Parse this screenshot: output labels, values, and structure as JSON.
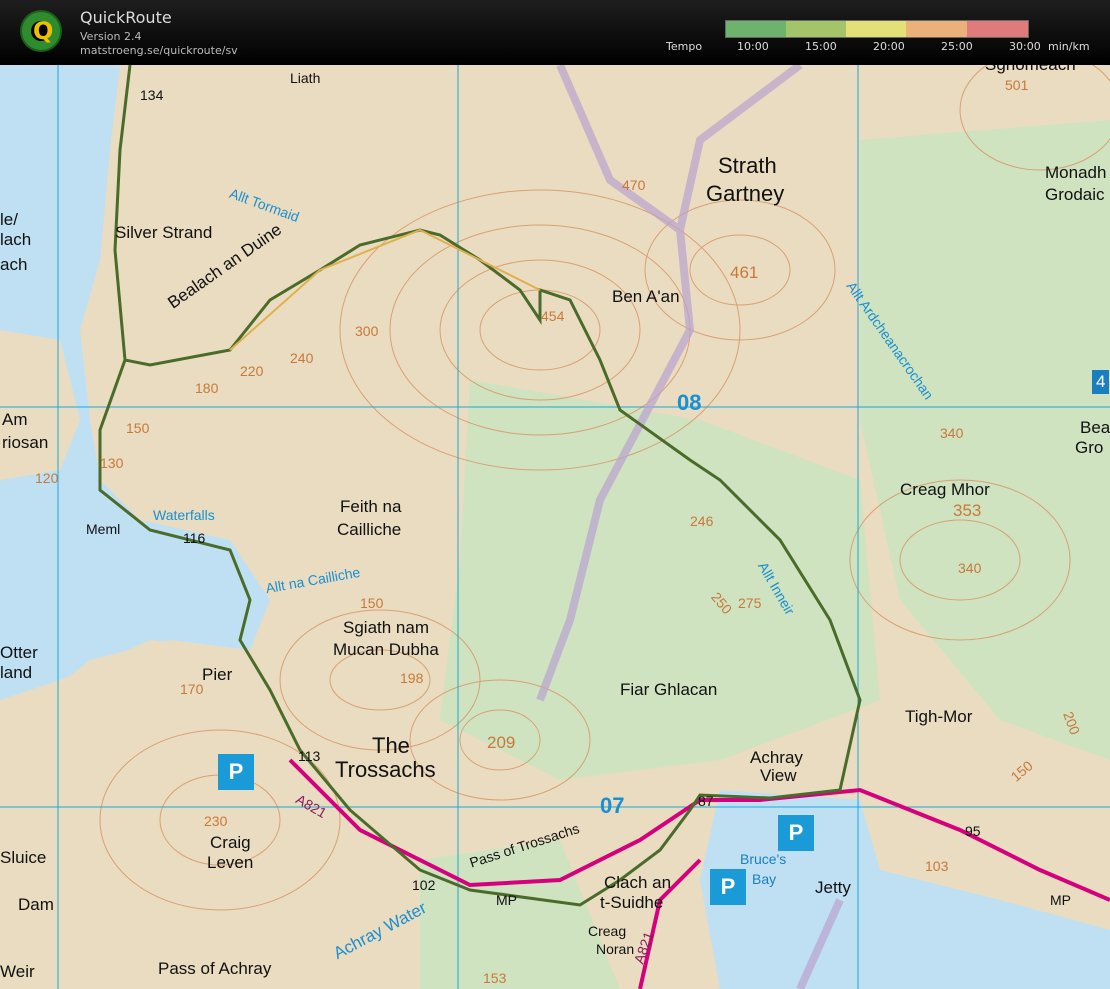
{
  "app": {
    "title": "QuickRoute",
    "version": "Version 2.4",
    "url": "matstroeng.se/quickroute/sv"
  },
  "legend": {
    "label": "Tempo",
    "unit": "min/km",
    "ticks": [
      "10:00",
      "15:00",
      "20:00",
      "25:00",
      "30:00"
    ],
    "colors": [
      "#6db36d",
      "#a4c46a",
      "#e4e078",
      "#eab27a",
      "#e07b7b"
    ]
  },
  "map": {
    "colors": {
      "land": "#e9dcc0",
      "water": "#bfe0f3",
      "forest": "#cfe3c1",
      "contour": "#d8905f",
      "road": "#d6007e",
      "grid": "#1aa8d8"
    },
    "labels": {
      "liath": "Liath",
      "n134": "134",
      "sgriomeach": "Sgriomeach",
      "n501": "501",
      "strath": "Strath",
      "gartney": "Gartney",
      "n470": "470",
      "monadh": "Monadh",
      "grodaic": "Grodaic",
      "silver_strand": "Silver Strand",
      "allt_tormaid": "Allt Tormaid",
      "le": "le/",
      "lach": "lach",
      "ach": "ach",
      "bealach": "Bealach an Duine",
      "n461": "461",
      "ben_aan": "Ben A'an",
      "n454": "454",
      "allt_ard": "Allt Ardcheanacrochan",
      "n300": "300",
      "n240": "240",
      "n180": "180",
      "n220": "220",
      "am": "Am",
      "riosan": "riosan",
      "n150a": "150",
      "n120": "120",
      "n130": "130",
      "grid08": "08",
      "n340a": "340",
      "bea": "Bea",
      "gro": "Gro",
      "creag_mhor": "Creag Mhor",
      "n353": "353",
      "n246": "246",
      "meml": "Meml",
      "waterfalls": "Waterfalls",
      "n116": "116",
      "feith_na": "Feith na",
      "cailliche": "Cailliche",
      "allt_na_cailliche": "Allt na Cailliche",
      "n275": "275",
      "n250": "250",
      "allt_inneir": "Allt Inneir",
      "n340b": "340",
      "n150b": "150",
      "sgiath": "Sgiath nam",
      "mucan": "Mucan Dubha",
      "otter": "Otter",
      "land": "land",
      "pier": "Pier",
      "n170": "170",
      "n198": "198",
      "fiar": "Fiar Ghlacan",
      "tigh_mor": "Tigh-Mor",
      "n209": "209",
      "the": "The",
      "trossachs": "Trossachs",
      "n113": "113",
      "achray": "Achray",
      "view": "View",
      "n200": "200",
      "n150c": "150",
      "a821a": "A821",
      "n230": "230",
      "craig": "Craig",
      "leven": "Leven",
      "grid07": "07",
      "n87": "87",
      "n95": "95",
      "pass_trossachs": "Pass of Trossachs",
      "bruces": "Bruce's",
      "bay": "Bay",
      "n103": "103",
      "sluice": "Sluice",
      "n102": "102",
      "clach": "Clach an",
      "tsuidhe": "t-Suidhe",
      "jetty": "Jetty",
      "dam": "Dam",
      "mp1": "MP",
      "mp2": "MP",
      "achray_water": "Achray Water",
      "creag_noran": "Creag",
      "noran": "Noran",
      "a821b": "A821",
      "pass_achray": "Pass of Achray",
      "n153": "153",
      "weir": "Weir",
      "n4": "4",
      "p1": "P",
      "p2": "P",
      "p3": "P"
    }
  }
}
